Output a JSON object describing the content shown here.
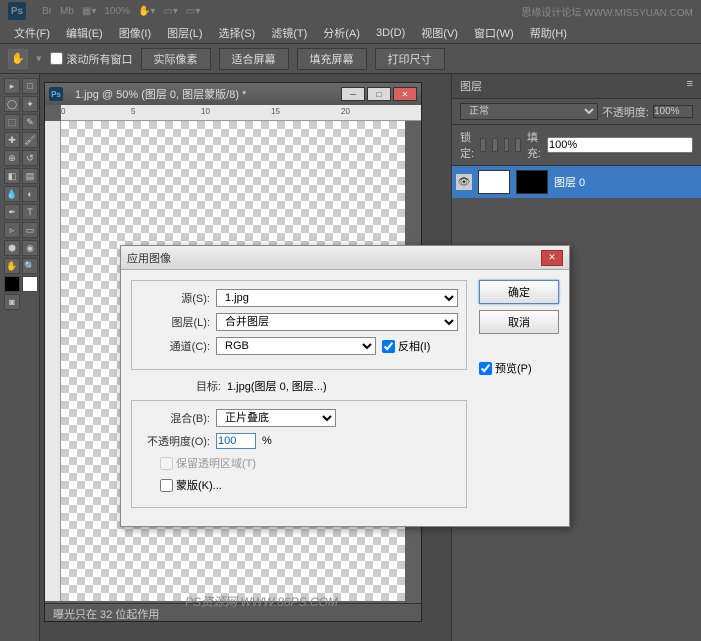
{
  "header": {
    "zoom": "100%",
    "watermark": "思缘设计论坛 WWW.MISSYUAN.COM"
  },
  "menu": {
    "file": "文件(F)",
    "edit": "编辑(E)",
    "image": "图像(I)",
    "layer": "图层(L)",
    "select": "选择(S)",
    "filter": "滤镜(T)",
    "analysis": "分析(A)",
    "3d": "3D(D)",
    "view": "视图(V)",
    "window": "窗口(W)",
    "help": "帮助(H)"
  },
  "options": {
    "scroll_all": "滚动所有窗口",
    "actual_pixels": "实际像素",
    "fit_screen": "适合屏幕",
    "fill_screen": "填充屏幕",
    "print_size": "打印尺寸"
  },
  "document": {
    "title": "1.jpg @ 50% (图层 0, 图层蒙版/8) *",
    "status": "曝光只在 32 位起作用"
  },
  "panels": {
    "layers_tab": "图层",
    "blend_mode": "正常",
    "opacity_label": "不透明度:",
    "opacity_value": "100%",
    "lock_label": "锁定:",
    "fill_label": "填充:",
    "fill_value": "100%",
    "layer_name": "图层 0"
  },
  "dialog": {
    "title": "应用图像",
    "source_label": "源(S):",
    "source_value": "1.jpg",
    "layer_label": "图层(L):",
    "layer_value": "合并图层",
    "channel_label": "通道(C):",
    "channel_value": "RGB",
    "invert_label": "反相(I)",
    "target_label": "目标:",
    "target_value": "1.jpg(图层 0, 图层...)",
    "blend_label": "混合(B):",
    "blend_value": "正片叠底",
    "opacity_label": "不透明度(O):",
    "opacity_value": "100",
    "opacity_unit": "%",
    "preserve_label": "保留透明区域(T)",
    "mask_label": "蒙版(K)...",
    "ok": "确定",
    "cancel": "取消",
    "preview": "预览(P)"
  },
  "watermark_canvas": "PS资源网 WWW.86PS.COM"
}
